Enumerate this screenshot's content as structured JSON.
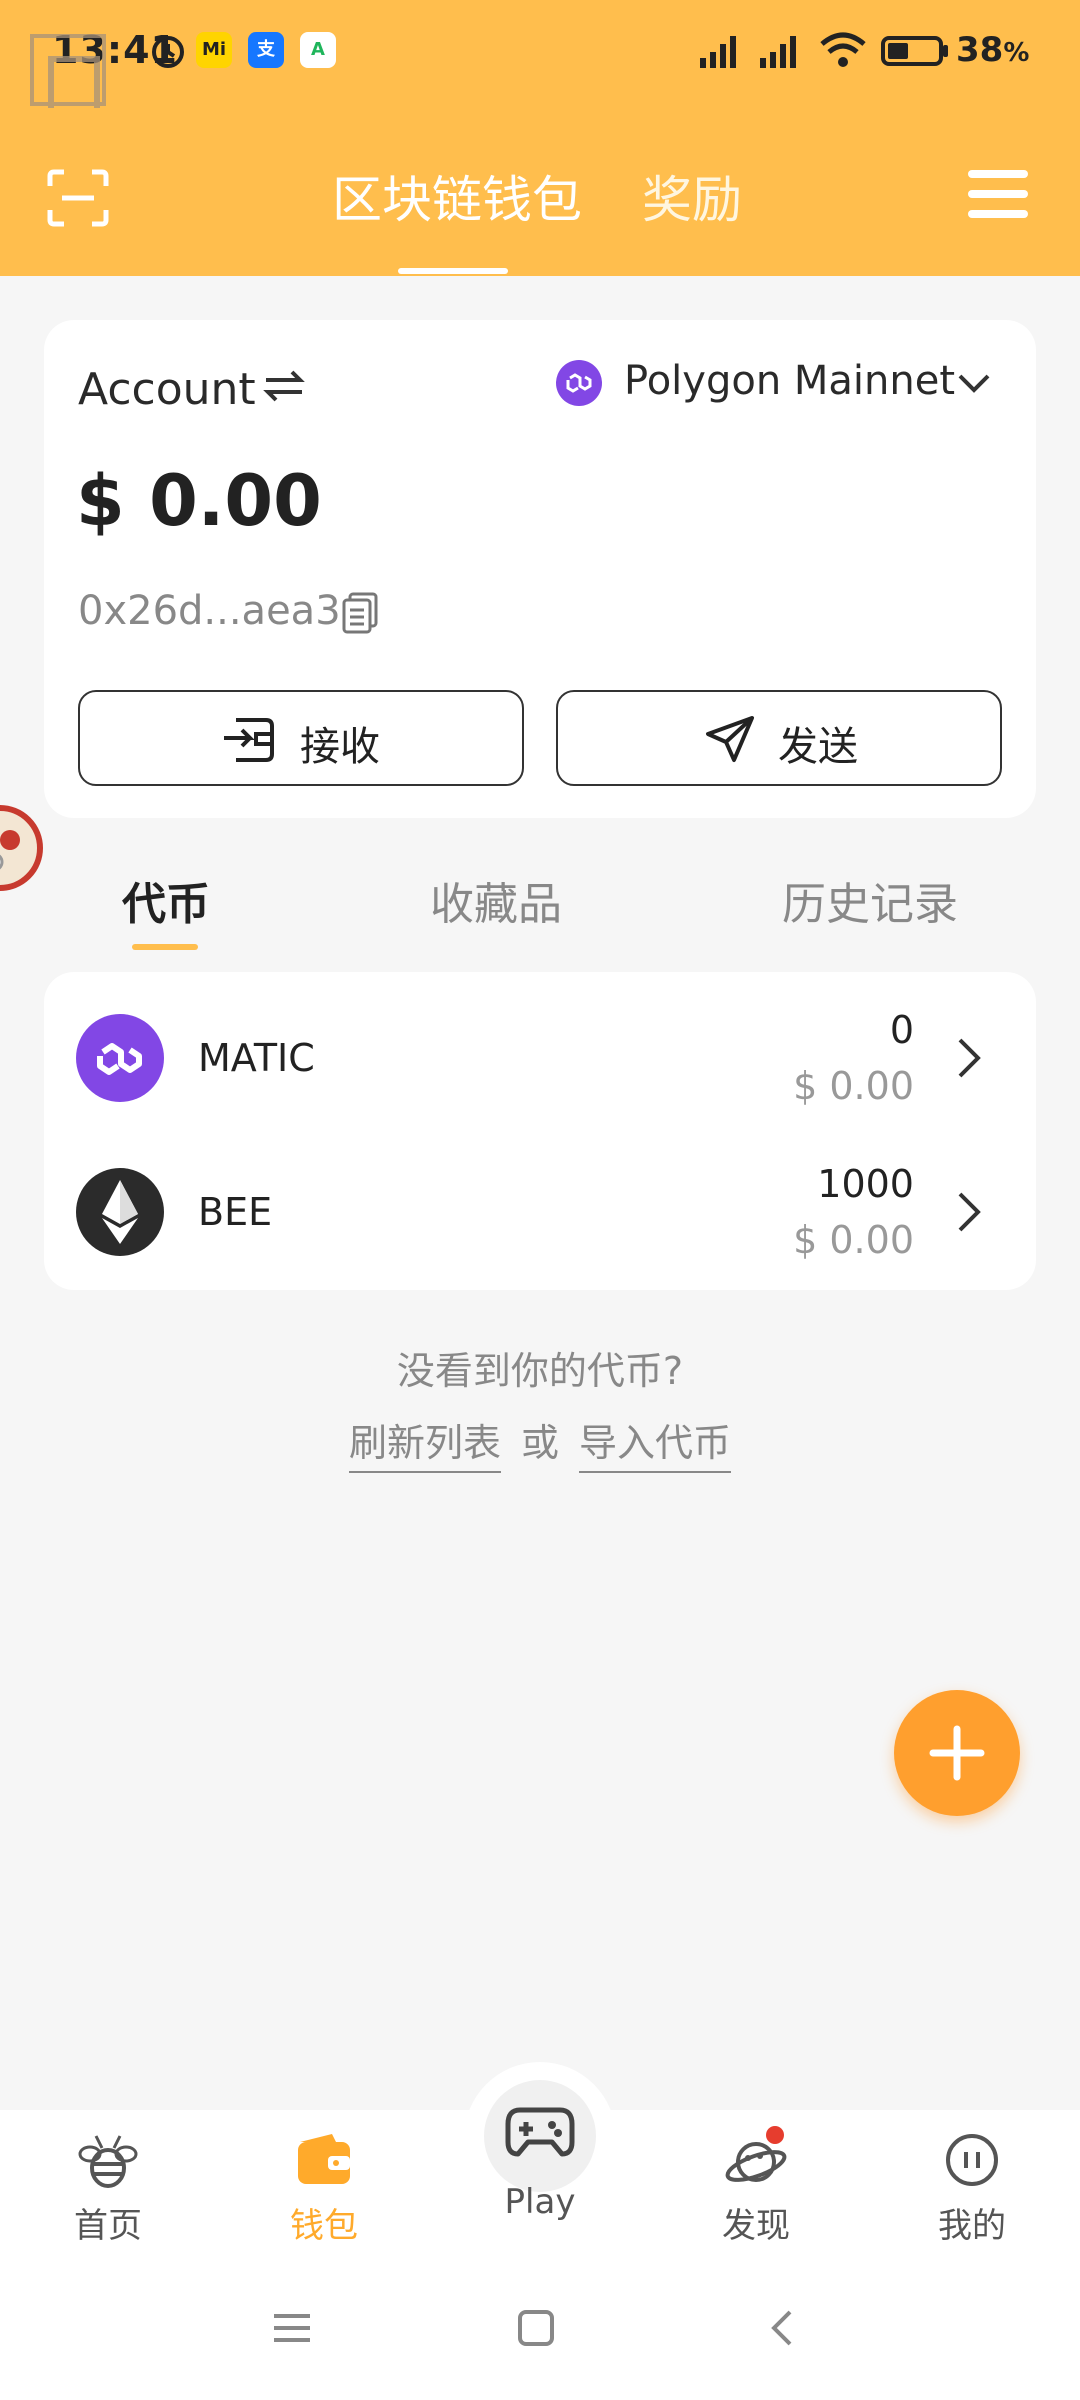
{
  "status_bar": {
    "time": "13:41",
    "battery_percent": "38",
    "battery_suffix": "%",
    "app_icons": [
      "alarm-icon",
      "mi-app-icon",
      "alipay-icon",
      "app-store-icon"
    ]
  },
  "header": {
    "tabs": [
      {
        "label": "区块链钱包",
        "active": true
      },
      {
        "label": "奖励",
        "active": false
      }
    ],
    "background_color": "#ffbe4d"
  },
  "account_card": {
    "account_label": "Account",
    "network": "Polygon Mainnet",
    "balance": "$ 0.00",
    "address": "0x26d...aea3",
    "receive_label": "接收",
    "send_label": "发送"
  },
  "subtabs": [
    {
      "label": "代币",
      "active": true
    },
    {
      "label": "收藏品",
      "active": false
    },
    {
      "label": "历史记录",
      "active": false
    }
  ],
  "tokens": [
    {
      "symbol": "MATIC",
      "amount": "0",
      "value": "$ 0.00",
      "icon": "polygon-icon",
      "color": "#8247e5"
    },
    {
      "symbol": "BEE",
      "amount": "1000",
      "value": "$ 0.00",
      "icon": "ethereum-icon",
      "color": "#2b2b2b"
    }
  ],
  "hint": {
    "question": "没看到你的代币?",
    "refresh_link": "刷新列表",
    "or": "或",
    "import_link": "导入代币"
  },
  "bottom_nav": {
    "items": [
      {
        "label": "首页",
        "icon": "bee-icon",
        "active": false
      },
      {
        "label": "钱包",
        "icon": "wallet-icon",
        "active": true
      },
      {
        "label": "Play",
        "icon": "gamepad-icon",
        "active": false
      },
      {
        "label": "发现",
        "icon": "planet-icon",
        "active": false
      },
      {
        "label": "我的",
        "icon": "profile-icon",
        "active": false
      }
    ],
    "accent_color": "#ffaa2b"
  }
}
